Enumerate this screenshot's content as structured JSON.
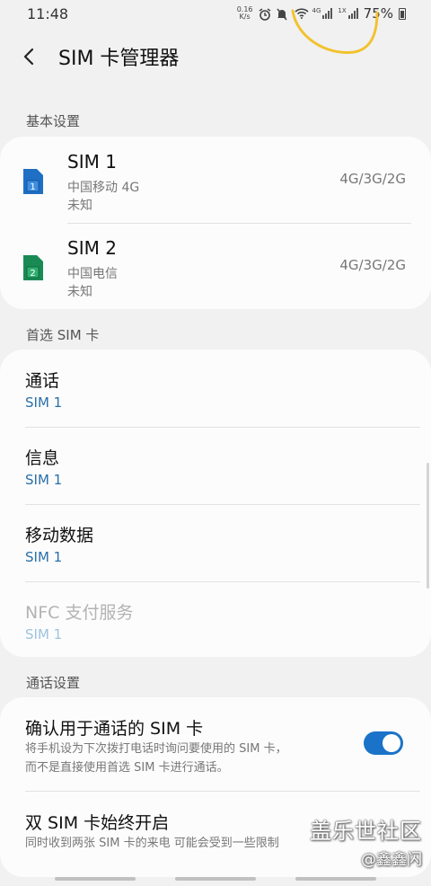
{
  "status_bar": {
    "time": "11:48",
    "net_speed_value": "0.16",
    "net_speed_unit": "K/s",
    "sig1_tag": "4G",
    "sig2_tag": "1X",
    "battery": "75%"
  },
  "header": {
    "title": "SIM 卡管理器"
  },
  "sections": {
    "basic": "基本设置",
    "preferred": "首选 SIM 卡",
    "call_settings": "通话设置"
  },
  "sims": [
    {
      "name": "SIM 1",
      "carrier": "中国移动 4G",
      "status": "未知",
      "network": "4G/3G/2G",
      "badge": "1",
      "color": "#1f6fc4"
    },
    {
      "name": "SIM 2",
      "carrier": "中国电信",
      "status": "未知",
      "network": "4G/3G/2G",
      "badge": "2",
      "color": "#1a8a55"
    }
  ],
  "preferred": [
    {
      "label": "通话",
      "value": "SIM 1"
    },
    {
      "label": "信息",
      "value": "SIM 1"
    },
    {
      "label": "移动数据",
      "value": "SIM 1"
    },
    {
      "label": "NFC 支付服务",
      "value": "SIM 1",
      "enabled": false
    }
  ],
  "call_settings": {
    "confirm_label": "确认用于通话的 SIM 卡",
    "confirm_desc_1": "将手机设为下次拨打电话时询问要使用的 SIM 卡，",
    "confirm_desc_2": "而不是直接使用首选 SIM 卡进行通话。",
    "confirm_enabled": true,
    "dual_label": "双 SIM 卡始终开启",
    "dual_desc": "同时收到两张 SIM 卡的来电 可能会受到一些限制"
  },
  "watermark": {
    "main": "盖乐世社区",
    "sub": "@鑫鑫闪"
  },
  "colors": {
    "accent": "#1a73c8",
    "value_blue": "#2a6fa8",
    "scribble": "#f2c230"
  }
}
